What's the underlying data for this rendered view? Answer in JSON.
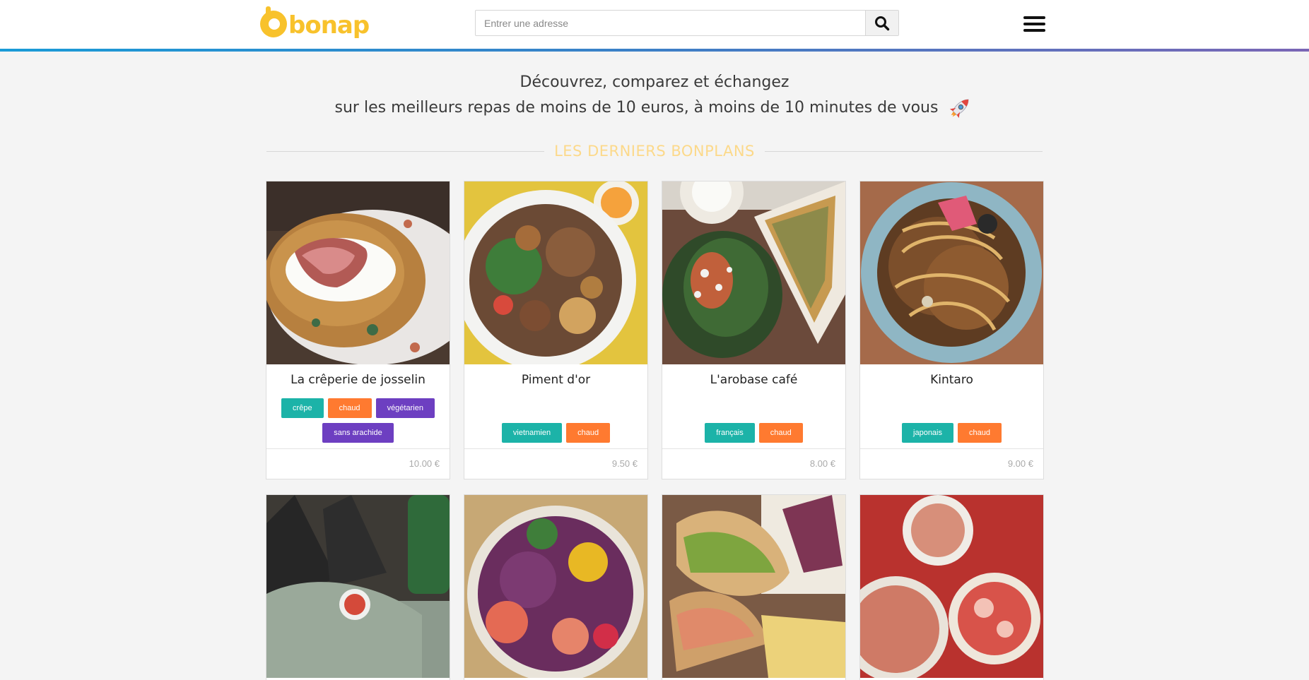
{
  "header": {
    "logo_text": "bonap",
    "search_placeholder": "Entrer une adresse"
  },
  "hero": {
    "line1": "Découvrez, comparez et échangez",
    "line2": "sur les meilleurs repas de moins de 10 euros, à moins de 10 minutes de vous"
  },
  "section": {
    "title": "LES DERNIERS BONPLANS"
  },
  "colors": {
    "brand_yellow": "#f8c22c",
    "tag_teal": "#1cb3a8",
    "tag_orange": "#ff7a30",
    "tag_purple": "#6d3fc1",
    "header_gradient_start": "#1a9bd7",
    "header_gradient_end": "#7a66b5"
  },
  "cards": [
    {
      "name": "La crêperie de josselin",
      "price": "10.00 €",
      "tags": [
        {
          "label": "crêpe",
          "color": "teal"
        },
        {
          "label": "chaud",
          "color": "orange"
        },
        {
          "label": "végétarien",
          "color": "purple"
        },
        {
          "label": "sans arachide",
          "color": "purple"
        }
      ]
    },
    {
      "name": "Piment d'or",
      "price": "9.50 €",
      "tags": [
        {
          "label": "vietnamien",
          "color": "teal"
        },
        {
          "label": "chaud",
          "color": "orange"
        }
      ]
    },
    {
      "name": "L'arobase café",
      "price": "8.00 €",
      "tags": [
        {
          "label": "français",
          "color": "teal"
        },
        {
          "label": "chaud",
          "color": "orange"
        }
      ]
    },
    {
      "name": "Kintaro",
      "price": "9.00 €",
      "tags": [
        {
          "label": "japonais",
          "color": "teal"
        },
        {
          "label": "chaud",
          "color": "orange"
        }
      ]
    }
  ]
}
